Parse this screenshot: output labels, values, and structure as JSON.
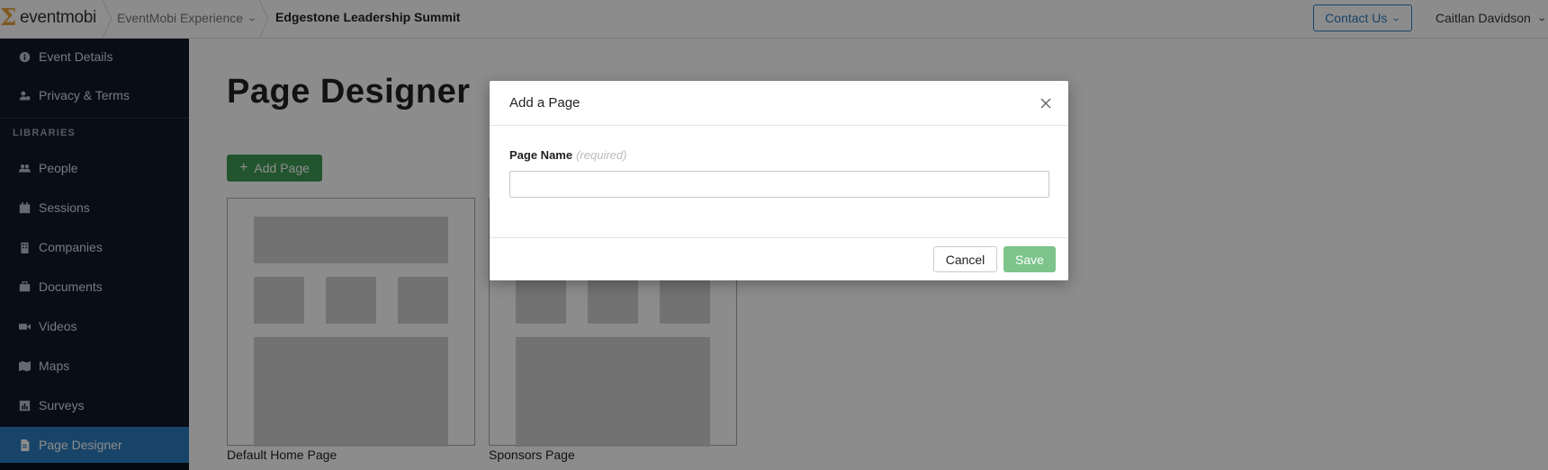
{
  "topbar": {
    "logo_text": "eventmobi",
    "breadcrumb_app": "EventMobi Experience",
    "breadcrumb_event": "Edgestone Leadership Summit",
    "contact_label": "Contact Us",
    "user_name": "Caitlan Davidson"
  },
  "sidebar": {
    "items_top": [
      {
        "label": "Event Details",
        "icon": "info-icon"
      },
      {
        "label": "Privacy & Terms",
        "icon": "user-lock-icon"
      }
    ],
    "section_heading": "LIBRARIES",
    "items": [
      {
        "label": "People",
        "icon": "people-icon"
      },
      {
        "label": "Sessions",
        "icon": "calendar-icon"
      },
      {
        "label": "Companies",
        "icon": "building-icon"
      },
      {
        "label": "Documents",
        "icon": "briefcase-icon"
      },
      {
        "label": "Videos",
        "icon": "video-icon"
      },
      {
        "label": "Maps",
        "icon": "map-icon"
      },
      {
        "label": "Surveys",
        "icon": "survey-icon"
      },
      {
        "label": "Page Designer",
        "icon": "page-icon",
        "active": true
      }
    ],
    "active_color": "#2d7dc0"
  },
  "main": {
    "title": "Page Designer",
    "add_page_label": "Add Page",
    "pages": [
      {
        "name": "Default Home Page"
      },
      {
        "name": "Sponsors Page"
      }
    ]
  },
  "modal": {
    "title": "Add a Page",
    "field_label": "Page Name",
    "field_required": "(required)",
    "field_value": "",
    "cancel_label": "Cancel",
    "save_label": "Save"
  },
  "colors": {
    "sidebar_bg": "#0e1a2b",
    "add_button": "#3e9c55",
    "save_button": "#7cc48a",
    "brand_accent": "#e8a33d"
  }
}
